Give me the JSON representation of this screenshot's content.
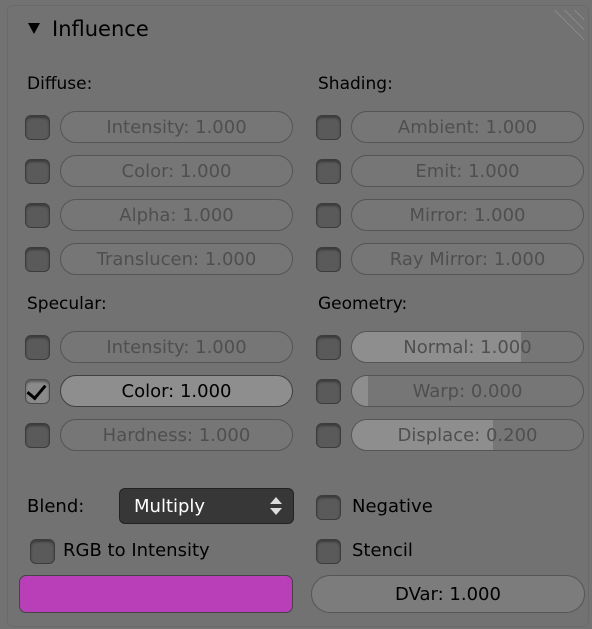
{
  "panel": {
    "title": "Influence"
  },
  "diffuse": {
    "label": "Diffuse:",
    "rows": [
      {
        "label": "Intensity",
        "value": "1.000",
        "text": "Intensity: 1.000",
        "enabled": false
      },
      {
        "label": "Color",
        "value": "1.000",
        "text": "Color: 1.000",
        "enabled": false
      },
      {
        "label": "Alpha",
        "value": "1.000",
        "text": "Alpha: 1.000",
        "enabled": false
      },
      {
        "label": "Translucen",
        "value": "1.000",
        "text": "Translucen: 1.000",
        "enabled": false
      }
    ]
  },
  "shading": {
    "label": "Shading:",
    "rows": [
      {
        "label": "Ambient",
        "value": "1.000",
        "text": "Ambient: 1.000",
        "enabled": false
      },
      {
        "label": "Emit",
        "value": "1.000",
        "text": "Emit: 1.000",
        "enabled": false
      },
      {
        "label": "Mirror",
        "value": "1.000",
        "text": "Mirror: 1.000",
        "enabled": false
      },
      {
        "label": "Ray Mirror",
        "value": "1.000",
        "text": "Ray Mirror: 1.000",
        "enabled": false
      }
    ]
  },
  "specular": {
    "label": "Specular:",
    "rows": [
      {
        "label": "Intensity",
        "value": "1.000",
        "text": "Intensity: 1.000",
        "enabled": false
      },
      {
        "label": "Color",
        "value": "1.000",
        "text": "Color: 1.000",
        "enabled": true
      },
      {
        "label": "Hardness",
        "value": "1.000",
        "text": "Hardness: 1.000",
        "enabled": false
      }
    ]
  },
  "geometry": {
    "label": "Geometry:",
    "rows": [
      {
        "label": "Normal",
        "value": "1.000",
        "text": "Normal: 1.000",
        "enabled": false,
        "slider_fraction": 0.73
      },
      {
        "label": "Warp",
        "value": "0.000",
        "text": "Warp: 0.000",
        "enabled": false,
        "slider_fraction": 0.07
      },
      {
        "label": "Displace",
        "value": "0.200",
        "text": "Displace: 0.200",
        "enabled": false,
        "slider_fraction": 0.61
      }
    ]
  },
  "blend": {
    "label": "Blend:",
    "selected": "Multiply"
  },
  "negative": {
    "label": "Negative",
    "checked": false
  },
  "rgb_to_intensity": {
    "label": "RGB to Intensity",
    "checked": false
  },
  "stencil": {
    "label": "Stencil",
    "checked": false
  },
  "color_swatch": {
    "color": "#b83fb8"
  },
  "dvar": {
    "text": "DVar: 1.000",
    "value": "1.000"
  },
  "colors": {
    "panel_bg": "#727272",
    "active_field": "#8e8e8e",
    "dropdown_bg": "#373737"
  }
}
